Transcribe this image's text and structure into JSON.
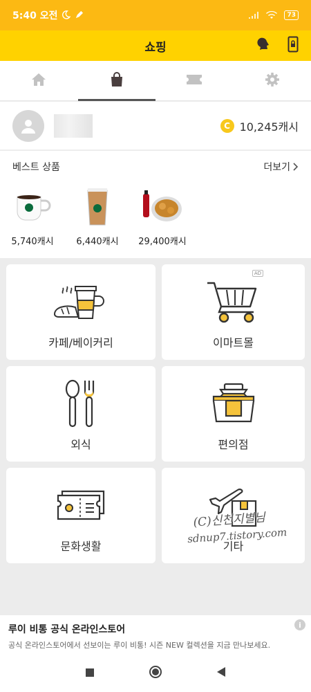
{
  "status": {
    "time": "5:40 오전",
    "battery": "73"
  },
  "header": {
    "title": "쇼핑"
  },
  "tabs": [
    {
      "icon": "home-icon"
    },
    {
      "icon": "shopping-bag-icon",
      "active": true
    },
    {
      "icon": "ticket-icon"
    },
    {
      "icon": "gear-icon"
    }
  ],
  "profile": {
    "cash": "10,245캐시",
    "coin_symbol": "C"
  },
  "best": {
    "title": "베스트 상품",
    "more": "더보기",
    "products": [
      {
        "price": "5,740캐시"
      },
      {
        "price": "6,440캐시"
      },
      {
        "price": "29,400캐시"
      }
    ]
  },
  "categories": [
    {
      "label": "카페/베이커리"
    },
    {
      "label": "이마트몰",
      "ad": "AD"
    },
    {
      "label": "외식"
    },
    {
      "label": "편의점"
    },
    {
      "label": "문화생활"
    },
    {
      "label": "기타"
    }
  ],
  "watermark": {
    "line1": "(C)신천지별님",
    "line2": "sdnup7.tistory.com"
  },
  "banner": {
    "title": "루이 비통 공식 온라인스토어",
    "subtitle": "공식 온라인스토어에서 선보이는 루이 비통! 시즌 NEW 컬렉션을 지금 만나보세요.",
    "info": "i"
  },
  "colors": {
    "brand_yellow": "#ffd200",
    "status_yellow": "#fcb913",
    "accent": "#f5c33b"
  }
}
